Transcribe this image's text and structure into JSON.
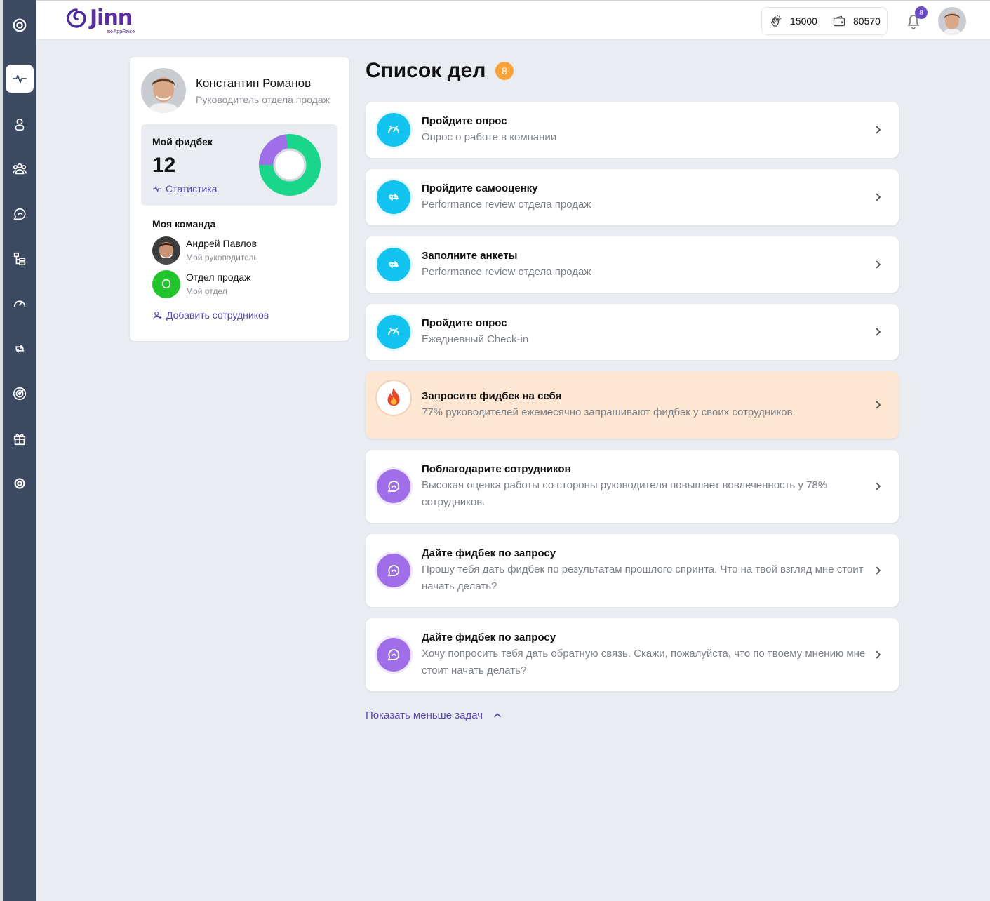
{
  "app": {
    "logo_text": "Jinn",
    "logo_subtitle": "ex-AppRaise"
  },
  "header": {
    "claps_value": "15000",
    "wallet_value": "80570",
    "notifications_count": "8"
  },
  "sidebar": {
    "items": [
      {
        "icon": "spiral-logo-icon"
      },
      {
        "icon": "pulse-icon",
        "active": true
      },
      {
        "icon": "person-icon"
      },
      {
        "icon": "people-group-icon"
      },
      {
        "icon": "feedback-chat-icon"
      },
      {
        "icon": "org-structure-icon"
      },
      {
        "icon": "speedometer-icon"
      },
      {
        "icon": "review-cycle-icon"
      },
      {
        "icon": "target-icon"
      },
      {
        "icon": "gift-icon"
      },
      {
        "icon": "settings-gear-icon"
      }
    ]
  },
  "profile": {
    "name": "Константин Романов",
    "role": "Руководитель отдела продаж",
    "feedback_title": "Мой фидбек",
    "feedback_count": "12",
    "stats_link": "Статистика",
    "donut": {
      "green_fraction": 0.77,
      "purple_fraction": 0.23,
      "colors": {
        "green": "#19d68a",
        "purple": "#a06ee8"
      }
    },
    "team_title": "Моя команда",
    "team": [
      {
        "name": "Андрей Павлов",
        "sub": "Мой руководитель",
        "avatar": "photo"
      },
      {
        "name": "Отдел продаж",
        "sub": "Мой отдел",
        "avatar": "O"
      }
    ],
    "add_employees": "Добавить сотрудников"
  },
  "todo": {
    "title": "Список дел",
    "count": "8",
    "tasks": [
      {
        "title": "Пройдите опрос",
        "subtitle": "Опрос о работе в компании",
        "icon": "speedometer-icon",
        "color": "blue"
      },
      {
        "title": "Пройдите самооценку",
        "subtitle": "Performance review отдела продаж",
        "icon": "review-cycle-icon",
        "color": "blue"
      },
      {
        "title": "Заполните анкеты",
        "subtitle": "Performance review отдела продаж",
        "icon": "review-cycle-icon",
        "color": "blue"
      },
      {
        "title": "Пройдите опрос",
        "subtitle": "Ежедневный Check-in",
        "icon": "speedometer-icon",
        "color": "blue"
      },
      {
        "title": "Запросите фидбек на себя",
        "subtitle": "77% руководителей ежемесячно запрашивают фидбек у своих сотрудников.",
        "icon": "fire-icon",
        "color": "highlight"
      },
      {
        "title": "Поблагодарите сотрудников",
        "subtitle": "Высокая оценка работы со стороны руководителя повышает вовлеченность у 78% сотрудников.",
        "icon": "feedback-chat-icon",
        "color": "purple"
      },
      {
        "title": "Дайте фидбек по запросу",
        "subtitle": "Прошу тебя дать фидбек по результатам прошлого спринта. Что на твой взгляд мне стоит начать делать?",
        "icon": "feedback-chat-icon",
        "color": "purple"
      },
      {
        "title": "Дайте фидбек по запросу",
        "subtitle": "Хочу попросить тебя дать обратную связь. Скажи, пожалуйста, что по твоему мнению мне стоит начать делать?",
        "icon": "feedback-chat-icon",
        "color": "purple"
      }
    ],
    "show_less": "Показать меньше задач"
  }
}
